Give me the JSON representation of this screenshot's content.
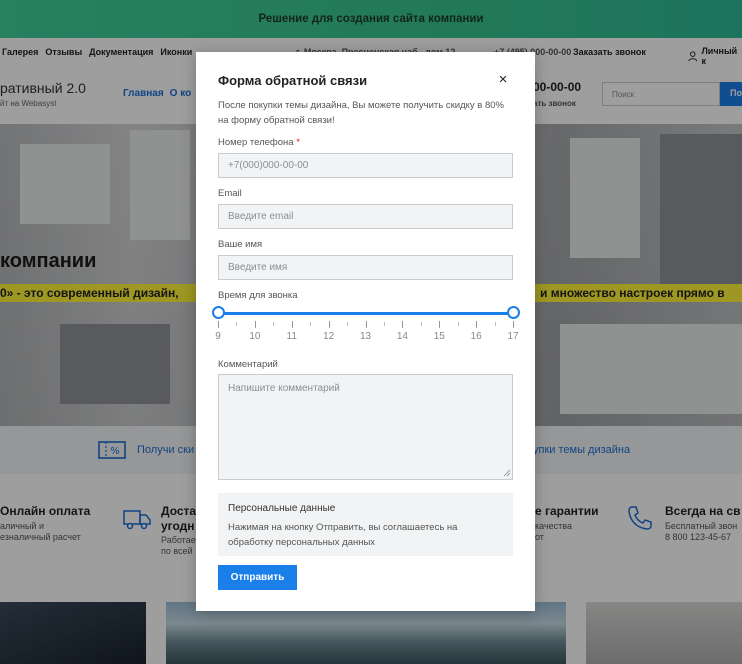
{
  "promo": {
    "text": "Решение для создания сайта компании"
  },
  "topnav": {
    "links": [
      "Галерея",
      "Отзывы",
      "Документация",
      "Иконки"
    ],
    "location": "г. Москва, Пресненская наб., дом 12",
    "phone": "+7 (495) 000-00-00",
    "callback": "Заказать звонок",
    "account": "Личный к"
  },
  "header": {
    "logo_name": "ративный 2.0",
    "logo_sub": "йт на Webasyst",
    "nav": [
      "Главная",
      "О ко"
    ],
    "phone": "00-00-00",
    "callback": "ать звонок",
    "search_placeholder": "Поиск",
    "search_button": "По"
  },
  "hero": {
    "title": "компании",
    "strip_left": "0» - это современный дизайн,",
    "strip_right": "и множество настроек прямо в"
  },
  "discount": {
    "text_left": "Получи ски",
    "text_right": "упки темы дизайна"
  },
  "features": [
    {
      "title": "Онлайн оплата",
      "sub": [
        "аличный и",
        "езналичный расчет"
      ]
    },
    {
      "title": "Доста",
      "title2": "угодн",
      "sub": [
        "Работае",
        "по всей"
      ]
    },
    {
      "title": "е гарантии",
      "sub": [
        "качества",
        "от"
      ]
    },
    {
      "title": "Всегда на св",
      "sub": [
        "Бесплатный звон",
        "8 800 123-45-67"
      ]
    }
  ],
  "modal": {
    "title": "Форма обратной связи",
    "close": "×",
    "description": "После покупки темы дизайна, Вы можете получить скидку в 80% на форму обратной связи!",
    "phone_label": "Номер телефона",
    "required_mark": "*",
    "phone_placeholder": "+7(000)000-00-00",
    "email_label": "Email",
    "email_placeholder": "Введите email",
    "name_label": "Ваше имя",
    "name_placeholder": "Введите имя",
    "time_label": "Время для звонка",
    "time_min": 9,
    "time_max": 17,
    "time_from": 9,
    "time_to": 17,
    "time_ticks": [
      "9",
      "10",
      "11",
      "12",
      "13",
      "14",
      "15",
      "16",
      "17"
    ],
    "comment_label": "Комментарий",
    "comment_placeholder": "Напишите комментарий",
    "consent_title": "Персональные данные",
    "consent_text": "Нажимая на кнопку Отправить, вы соглашаетесь на обработку персональных данных",
    "submit": "Отправить"
  },
  "colors": {
    "accent": "#1a7fe8",
    "promo_green": "#3fd09a",
    "highlight_yellow": "#fff43a",
    "required": "#e02020"
  }
}
